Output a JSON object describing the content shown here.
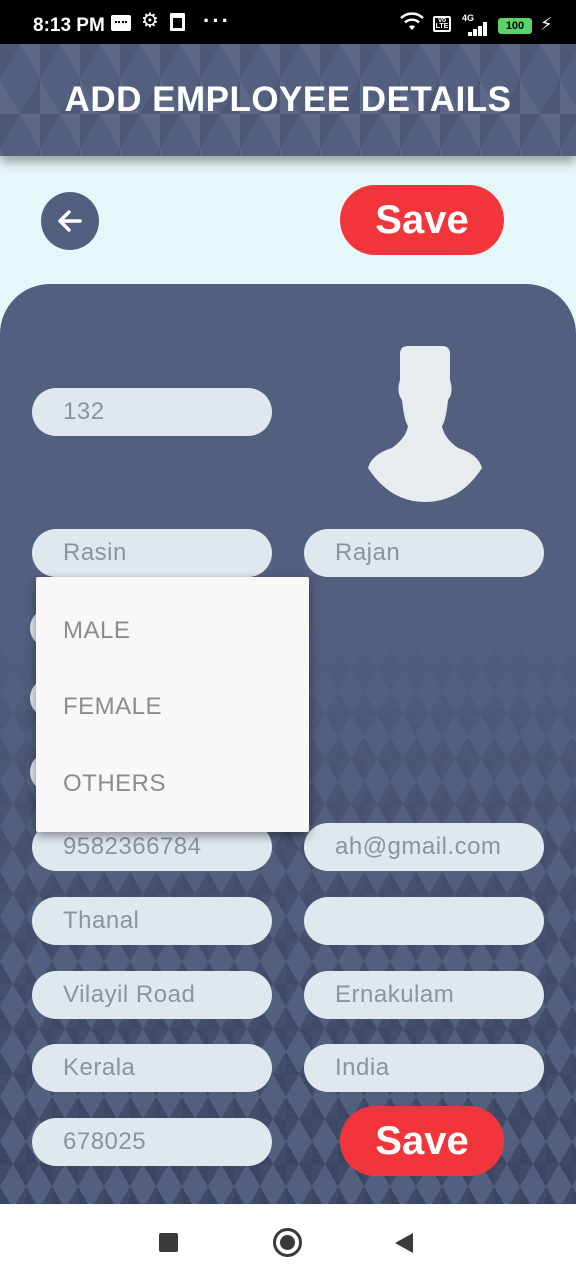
{
  "status_bar": {
    "time": "8:13 PM",
    "dots": "···",
    "network": "4G",
    "volte": "Vo LTE",
    "battery": "100"
  },
  "header": {
    "title": "ADD EMPLOYEE DETAILS"
  },
  "toolbar": {
    "save_label": "Save"
  },
  "form": {
    "employee_id": "132",
    "first_name": "Rasin",
    "last_name": "Rajan",
    "phone": "9582366784",
    "email": "ah@gmail.com",
    "house_name": "Thanal",
    "field_right_2": "",
    "street": "Vilayil Road",
    "city": "Ernakulam",
    "state": "Kerala",
    "country": "India",
    "pincode": "678025"
  },
  "gender_dropdown": {
    "options": [
      "MALE",
      "FEMALE",
      "OTHERS"
    ]
  },
  "bottom": {
    "save_label": "Save"
  },
  "colors": {
    "primary": "#535f7f",
    "accent": "#f2353b",
    "background": "#e6f7f9",
    "field": "#dfe7ef"
  },
  "icons": {
    "back": "arrow-left-icon",
    "avatar": "person-silhouette-icon"
  }
}
